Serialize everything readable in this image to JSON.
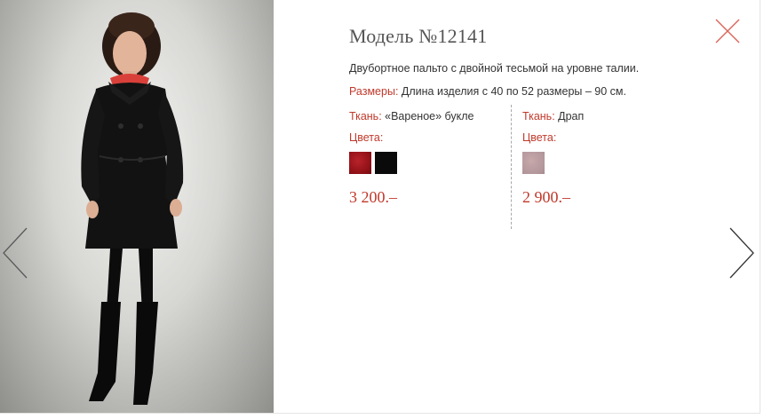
{
  "product": {
    "title": "Модель №12141",
    "description": "Двубортное пальто с двойной тесьмой на уровне талии.",
    "sizes_label": "Размеры:",
    "sizes_value": " Длина изделия с 40 по 52 размеры – 90 см."
  },
  "variants": [
    {
      "fabric_label": "Ткань:",
      "fabric_value": " «Вареное» букле",
      "colors_label": "Цвета:",
      "swatches": [
        {
          "name": "burgundy-red",
          "color": "#9c1418"
        },
        {
          "name": "black",
          "color": "#0a0a0a"
        }
      ],
      "price": "3 200.–"
    },
    {
      "fabric_label": "Ткань:",
      "fabric_value": " Драп",
      "colors_label": "Цвета:",
      "swatches": [
        {
          "name": "dusty-rose",
          "color": "#b89a9e"
        }
      ],
      "price": "2 900.–"
    }
  ],
  "icons": {
    "close": "close-icon",
    "prev": "chevron-left-icon",
    "next": "chevron-right-icon"
  },
  "colors": {
    "accent": "#c0392b",
    "text": "#333333",
    "title": "#555555",
    "close": "#d9665a"
  }
}
